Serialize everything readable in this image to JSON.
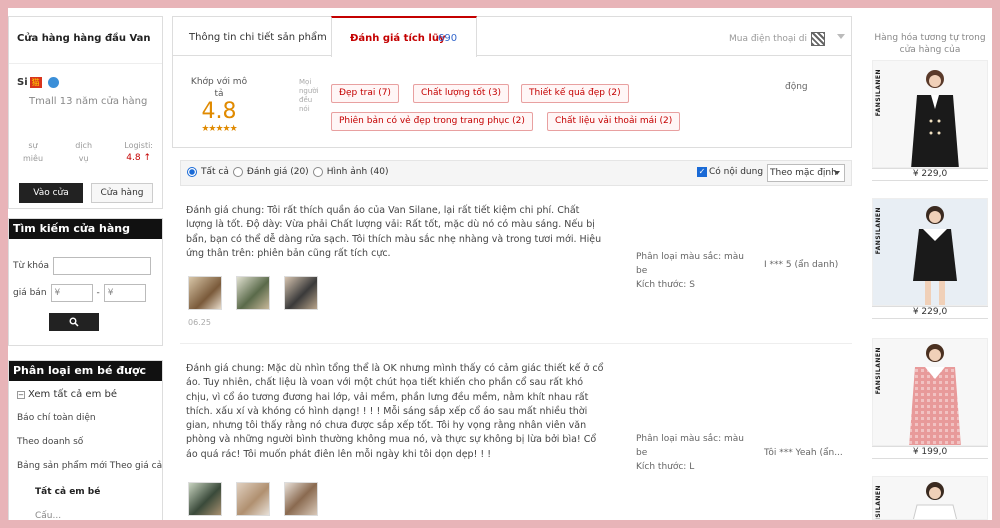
{
  "shop": {
    "title": "Cửa hàng hàng đầu Van",
    "seller_name": "Si",
    "tmall_years": "Tmall 13 năm cửa hàng",
    "scores": [
      {
        "label": "sự\nmiêu",
        "value": ""
      },
      {
        "label": "dịch\nvụ",
        "value": ""
      },
      {
        "label": "Logisti:",
        "value": "4.8 ↑"
      }
    ],
    "enter_label": "Vào cửa",
    "store_label": "Cửa hàng"
  },
  "search": {
    "header": "Tìm kiếm cửa hàng",
    "keyword_label": "Từ khóa",
    "price_label": "giá bán",
    "price_from": "¥",
    "price_to": "¥",
    "dash": "-"
  },
  "categories": {
    "header": "Phân loại em bé được cả",
    "view_all": "Xem tất cả em bé",
    "items": [
      "Báo chí toàn diện",
      "Theo doanh số",
      "Bảng sản phẩm mới Theo giá cả"
    ],
    "all_babies": "Tất cả em bé",
    "cut_item": "Cấu..."
  },
  "tabs": {
    "details": "Thông tin chi tiết sản phẩm",
    "reviews": "Đánh giá tích lũy",
    "reviews_count": "690",
    "buy_phone": "Mua điện thoại di"
  },
  "summary": {
    "match_label": "Khớp với mô tả",
    "score": "4.8",
    "stars": "★★★★★",
    "impress_label": "Mọi người đều nói",
    "tags": [
      "Đẹp trai (7)",
      "Chất lượng tốt (3)",
      "Thiết kế quá đẹp (2)",
      "Phiên bản có vẻ đẹp trong trang phục (2)",
      "Chất liệu vải thoải mái (2)"
    ],
    "extra": "động"
  },
  "filters": {
    "all": "Tất cả",
    "rated": "Đánh giá (20)",
    "images": "Hình ảnh (40)",
    "has_content": "Có nội dung",
    "sort": "Theo mặc định"
  },
  "reviews": [
    {
      "text": "Đánh giá chung: Tôi rất thích quần áo của Van Silane, lại rất tiết kiệm chi phí. Chất lượng là tốt. Độ dày: Vừa phải Chất lượng vải: Rất tốt, mặc dù nó có màu sáng. Nếu bị bẩn, bạn có thể dễ dàng rửa sạch. Tôi thích màu sắc nhẹ nhàng và trong tươi mới. Hiệu ứng thân trên: phiên bản cũng rất tích cực.",
      "date": "06.25",
      "meta_color": "Phân loại màu sắc: màu be",
      "meta_size": "Kích thước: S",
      "user": "I *** 5 (ẩn danh)"
    },
    {
      "text": "Đánh giá chung: Mặc dù nhìn tổng thể là OK nhưng mình thấy có cảm giác thiết kế ở cổ áo. Tuy nhiên, chất liệu là voan với một chút họa tiết khiến cho phần cổ sau rất khó chịu, vì cổ áo tương đương hai lớp, vải mềm, phần lưng đều mềm, nằm khít nhau rất thích. xấu xí và khóng có hình dạng! ! ! ! Mỗi sáng sắp xếp cổ áo sau mất nhiều thời gian, nhưng tôi thấy rằng nó chưa được sắp xếp tốt. Tôi hy vọng rằng nhân viên văn phòng và những người bình thường không mua nó, và thực sự không bị lừa bởi bìa! Cổ áo quá rác! Tôi muốn phát điên lên mỗi ngày khi tôi dọn dẹp! ! !",
      "date": "",
      "meta_color": "Phân loại màu sắc: màu be",
      "meta_size": "Kích thước: L",
      "user": "Tôi *** Yeah (ẩn..."
    }
  ],
  "related": {
    "header": "Hàng hóa tương tự trong cửa hàng của",
    "brand": "FANSILANEN",
    "items": [
      {
        "price": "¥ 229,0"
      },
      {
        "price": "¥ 229,0"
      },
      {
        "price": "¥ 199,0"
      },
      {
        "price": ""
      }
    ]
  }
}
